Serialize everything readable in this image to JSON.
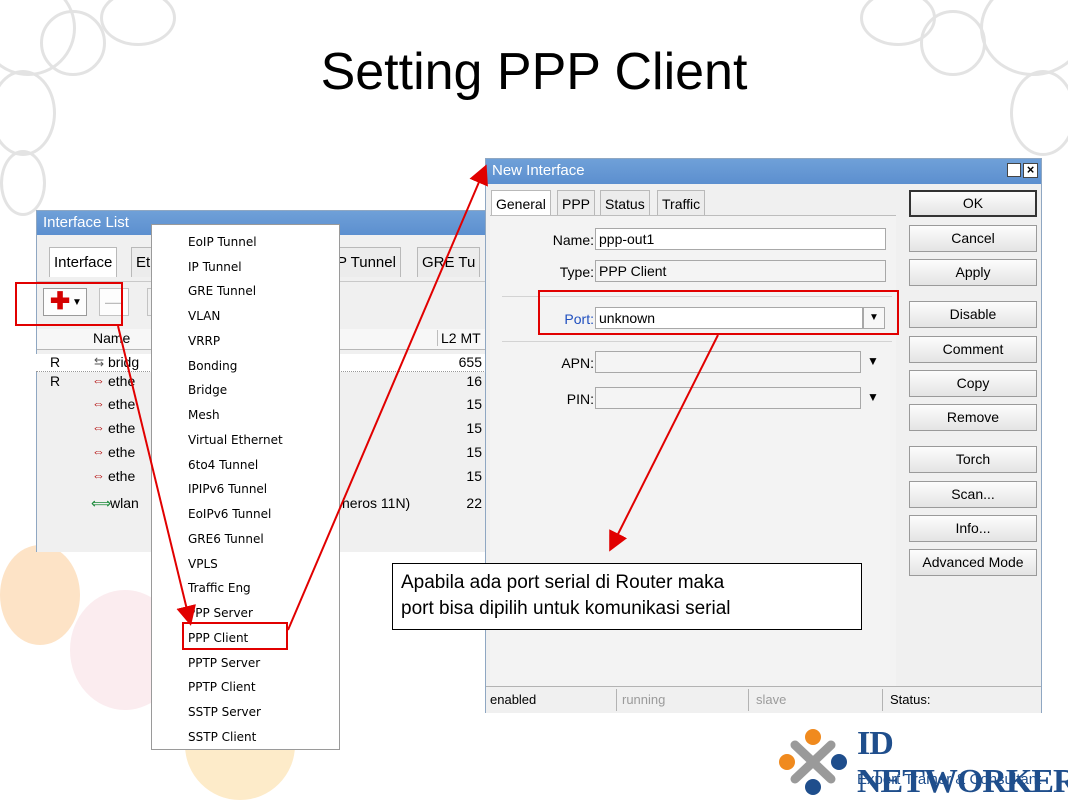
{
  "slide": {
    "title": "Setting PPP Client"
  },
  "interface_list": {
    "window_title": "Interface List",
    "tabs": [
      "Interface",
      "Et",
      "P Tunnel",
      "GRE Tu"
    ],
    "column_name": "Name",
    "column_l2mtu": "L2 MT",
    "rows": [
      {
        "flag": "R",
        "name": "bridg",
        "l2mtu": "655",
        "icon": "bridge-icon"
      },
      {
        "flag": "R",
        "name": "ethe",
        "l2mtu": "16",
        "icon": "ethernet-icon"
      },
      {
        "flag": "",
        "name": "ethe",
        "l2mtu": "15",
        "icon": "ethernet-icon"
      },
      {
        "flag": "",
        "name": "ethe",
        "l2mtu": "15",
        "icon": "ethernet-icon"
      },
      {
        "flag": "",
        "name": "ethe",
        "l2mtu": "15",
        "icon": "ethernet-icon"
      },
      {
        "flag": "",
        "name": "ethe",
        "l2mtu": "15",
        "icon": "ethernet-icon"
      },
      {
        "flag": "",
        "name": "wlan",
        "l2mtu": "22",
        "icon": "wireless-icon",
        "extra": "heros 11N)"
      }
    ]
  },
  "add_menu": {
    "items": [
      "EoIP Tunnel",
      "IP Tunnel",
      "GRE Tunnel",
      "VLAN",
      "VRRP",
      "Bonding",
      "Bridge",
      "Mesh",
      "Virtual Ethernet",
      "6to4 Tunnel",
      "IPIPv6 Tunnel",
      "EoIPv6 Tunnel",
      "GRE6 Tunnel",
      "VPLS",
      "Traffic Eng",
      "PPP Server",
      "PPP Client",
      "PPTP Server",
      "PPTP Client",
      "SSTP Server",
      "SSTP Client"
    ],
    "highlighted": "PPP Client"
  },
  "new_interface": {
    "window_title": "New Interface",
    "tabs": [
      "General",
      "PPP",
      "Status",
      "Traffic"
    ],
    "fields": {
      "name_label": "Name:",
      "name_value": "ppp-out1",
      "type_label": "Type:",
      "type_value": "PPP Client",
      "port_label": "Port:",
      "port_value": "unknown",
      "apn_label": "APN:",
      "apn_value": "",
      "pin_label": "PIN:",
      "pin_value": ""
    },
    "buttons": [
      "OK",
      "Cancel",
      "Apply",
      "Disable",
      "Comment",
      "Copy",
      "Remove",
      "Torch",
      "Scan...",
      "Info...",
      "Advanced Mode"
    ],
    "status_bar": [
      "enabled",
      "running",
      "slave",
      "Status:"
    ]
  },
  "callout": {
    "line1": "Apabila ada port serial di Router maka",
    "line2": "port bisa dipilih untuk komunikasi serial"
  },
  "brand": {
    "name": "ID NETWORKERS",
    "tagline": "Expert Trainer & Consultant"
  },
  "colors": {
    "accent_red": "#e10000",
    "brand_orange": "#f08a1e",
    "brand_blue": "#1f4e8c",
    "titlebar_blue": "#5c8fcf"
  }
}
